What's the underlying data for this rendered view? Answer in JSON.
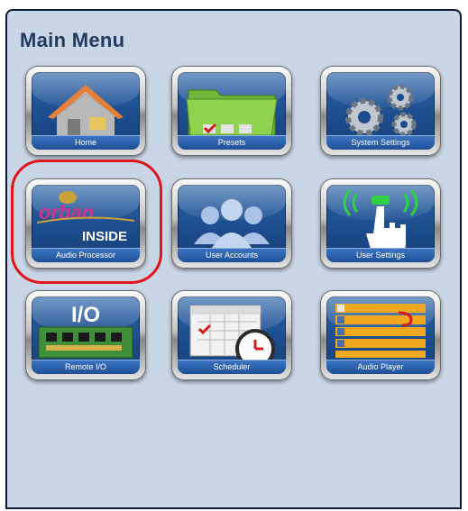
{
  "menu": {
    "title": "Main Menu",
    "tiles": [
      {
        "label": "Home",
        "icon": "house-icon"
      },
      {
        "label": "Presets",
        "icon": "folder-icon"
      },
      {
        "label": "System Settings",
        "icon": "gears-icon"
      },
      {
        "label": "Audio Processor",
        "icon": "orban-inside-logo",
        "logo_text": {
          "brand": "orban",
          "tagline": "INSIDE"
        }
      },
      {
        "label": "User Accounts",
        "icon": "users-icon"
      },
      {
        "label": "User Settings",
        "icon": "touch-hand-icon"
      },
      {
        "label": "Remote I/O",
        "icon": "circuit-board-icon",
        "badge": "I/O"
      },
      {
        "label": "Scheduler",
        "icon": "calendar-clock-icon"
      },
      {
        "label": "Audio Player",
        "icon": "playlist-icon"
      }
    ]
  },
  "colors": {
    "panel_bg": "#c9d6e6",
    "title": "#24395e",
    "tile_face": "#1c4c8c",
    "highlight_ring": "#e0141a"
  }
}
